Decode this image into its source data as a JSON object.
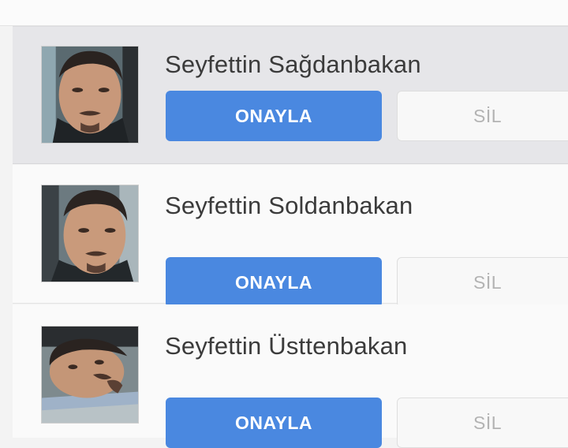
{
  "requests": [
    {
      "name": "Seyfettin Sağdanbakan",
      "approve_label": "ONAYLA",
      "delete_label": "SİL",
      "avatar_icon": "profile-photo-icon"
    },
    {
      "name": "Seyfettin Soldanbakan",
      "approve_label": "ONAYLA",
      "delete_label": "SİL",
      "avatar_icon": "profile-photo-icon"
    },
    {
      "name": "Seyfettin Üsttenbakan",
      "approve_label": "ONAYLA",
      "delete_label": "SİL",
      "avatar_icon": "profile-photo-icon"
    }
  ],
  "colors": {
    "approve_button": "#4a88e0",
    "delete_button": "#f8f8f8",
    "highlight_row": "#e6e6e9"
  }
}
